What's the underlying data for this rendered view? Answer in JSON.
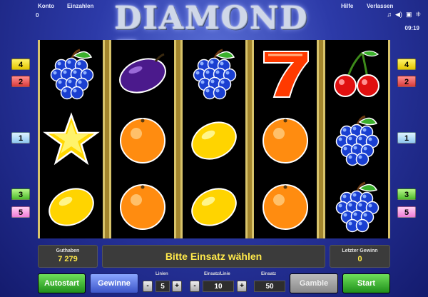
{
  "menu": {
    "konto": "Konto",
    "einzahlen": "Einzahlen",
    "hilfe": "Hilfe",
    "verlassen": "Verlassen",
    "counter": "0",
    "clock": "09:19"
  },
  "header_icons": [
    "music-icon",
    "volume-icon",
    "fullscreen-icon",
    "settings-icon"
  ],
  "logo": {
    "text": "DIAMOND",
    "seven": "7"
  },
  "reels": [
    [
      "grapes",
      "star",
      "lemon"
    ],
    [
      "plum",
      "orange",
      "orange"
    ],
    [
      "grapes",
      "lemon",
      "lemon"
    ],
    [
      "seven",
      "orange",
      "orange"
    ],
    [
      "cherries",
      "grapes",
      "grapes"
    ]
  ],
  "line_markers": {
    "left": [
      {
        "label": "4",
        "color": "yellow"
      },
      {
        "label": "2",
        "color": "red"
      },
      {
        "label": "1",
        "color": "blue"
      },
      {
        "label": "3",
        "color": "green"
      },
      {
        "label": "5",
        "color": "pink"
      }
    ],
    "right": [
      {
        "label": "4",
        "color": "yellow"
      },
      {
        "label": "2",
        "color": "red"
      },
      {
        "label": "1",
        "color": "blue"
      },
      {
        "label": "3",
        "color": "green"
      },
      {
        "label": "5",
        "color": "pink"
      }
    ]
  },
  "info": {
    "balance_label": "Guthaben",
    "balance_value": "7 279",
    "message": "Bitte Einsatz wählen",
    "last_win_label": "Letzter Gewinn",
    "last_win_value": "0"
  },
  "controls": {
    "autostart": "Autostart",
    "gewinne": "Gewinne",
    "lines_label": "Linien",
    "lines_value": "5",
    "bet_per_line_label": "Einsatz/Linie",
    "bet_per_line_value": "10",
    "total_bet_label": "Einsatz",
    "total_bet_value": "50",
    "gamble": "Gamble",
    "start": "Start",
    "minus": "-",
    "plus": "+"
  }
}
